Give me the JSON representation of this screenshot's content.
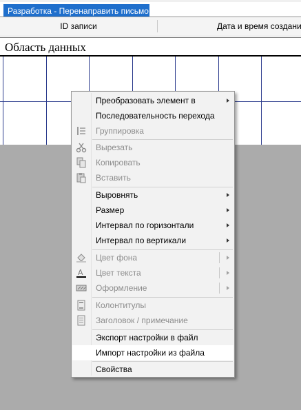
{
  "window": {
    "title": "Разработка - Перенаправить письмо"
  },
  "table_header": {
    "columns": [
      "ID записи",
      "Дата и время создания"
    ]
  },
  "section": {
    "label": "Область данных"
  },
  "context_menu": {
    "items": [
      {
        "label": "Преобразовать элемент в",
        "enabled": true,
        "submenu": true,
        "icon": ""
      },
      {
        "label": "Последовательность перехода",
        "enabled": true,
        "submenu": false,
        "icon": ""
      },
      {
        "label": "Группировка",
        "enabled": false,
        "submenu": false,
        "icon": "grouping-icon"
      },
      {
        "label": "Вырезать",
        "enabled": false,
        "submenu": false,
        "icon": "scissors-icon"
      },
      {
        "label": "Копировать",
        "enabled": false,
        "submenu": false,
        "icon": "copy-icon"
      },
      {
        "label": "Вставить",
        "enabled": false,
        "submenu": false,
        "icon": "paste-icon"
      },
      {
        "label": "Выровнять",
        "enabled": true,
        "submenu": true,
        "icon": ""
      },
      {
        "label": "Размер",
        "enabled": true,
        "submenu": true,
        "icon": ""
      },
      {
        "label": "Интервал по горизонтали",
        "enabled": true,
        "submenu": true,
        "icon": ""
      },
      {
        "label": "Интервал по вертикали",
        "enabled": true,
        "submenu": true,
        "icon": ""
      },
      {
        "label": "Цвет фона",
        "enabled": false,
        "submenu": true,
        "icon": "fill-color-icon"
      },
      {
        "label": "Цвет текста",
        "enabled": false,
        "submenu": true,
        "icon": "font-color-icon"
      },
      {
        "label": "Оформление",
        "enabled": false,
        "submenu": true,
        "icon": "special-effect-icon"
      },
      {
        "label": "Колонтитулы",
        "enabled": false,
        "submenu": false,
        "icon": "header-footer-icon"
      },
      {
        "label": "Заголовок / примечание",
        "enabled": false,
        "submenu": false,
        "icon": "header-note-icon"
      },
      {
        "label": "Экспорт настройки в файл",
        "enabled": true,
        "submenu": false,
        "icon": ""
      },
      {
        "label": "Импорт настройки из файла",
        "enabled": true,
        "submenu": false,
        "icon": "",
        "highlighted": true
      },
      {
        "label": "Свойства",
        "enabled": true,
        "submenu": false,
        "icon": ""
      }
    ]
  },
  "colors": {
    "title_tab": "#1f6fcc",
    "grid_lines": "#2a3a8c",
    "workspace": "#ababab",
    "menu_bg": "#f2f2f2"
  }
}
